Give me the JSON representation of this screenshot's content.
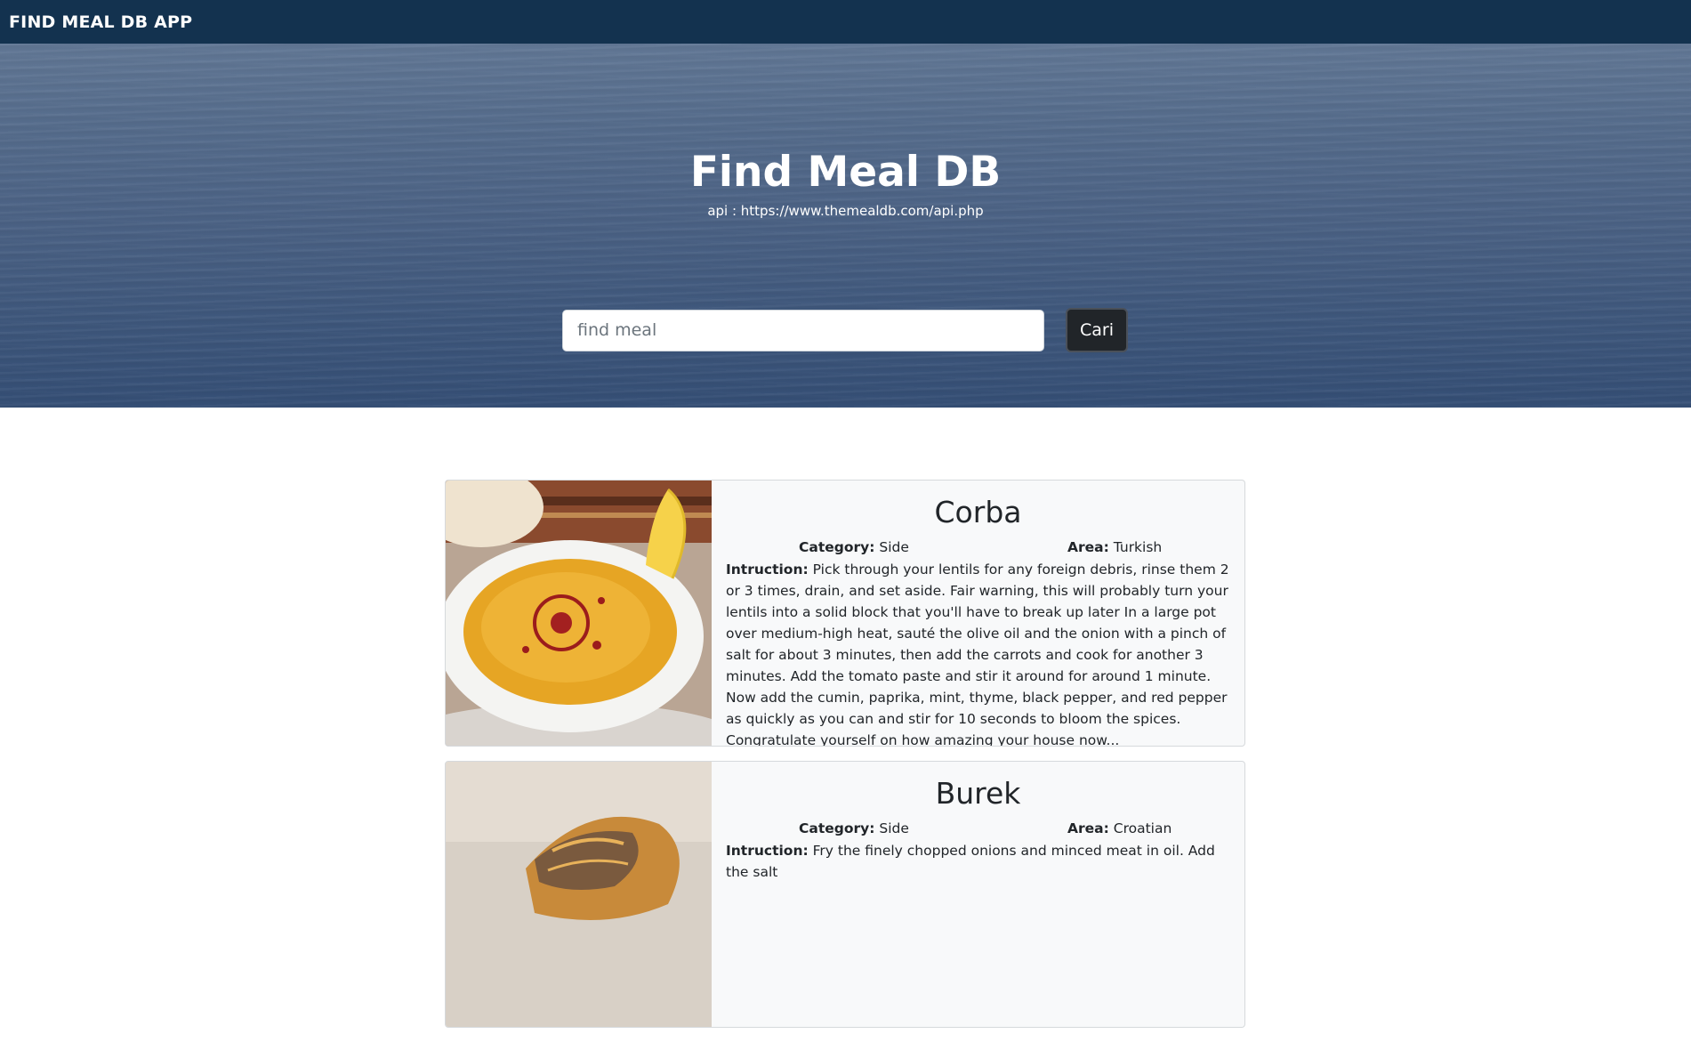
{
  "navbar": {
    "brand": "FIND MEAL DB APP"
  },
  "hero": {
    "title": "Find Meal DB",
    "api_note": "api : https://www.themealdb.com/api.php",
    "search": {
      "placeholder": "find meal",
      "value": "",
      "button_label": "Cari"
    }
  },
  "labels": {
    "category": "Category:",
    "area": "Area:",
    "instruction": "Intruction:"
  },
  "meals": [
    {
      "name": "Corba",
      "category": "Side",
      "area": "Turkish",
      "instruction": "Pick through your lentils for any foreign debris, rinse them 2 or 3 times, drain, and set aside. Fair warning, this will probably turn your lentils into a solid block that you'll have to break up later In a large pot over medium-high heat, sauté the olive oil and the onion with a pinch of salt for about 3 minutes, then add the carrots and cook for another 3 minutes. Add the tomato paste and stir it around for around 1 minute. Now add the cumin, paprika, mint, thyme, black pepper, and red pepper as quickly as you can and stir for 10 seconds to bloom the spices. Congratulate yourself on how amazing your house now..."
    },
    {
      "name": "Burek",
      "category": "Side",
      "area": "Croatian",
      "instruction": "Fry the finely chopped onions and minced meat in oil. Add the salt"
    }
  ]
}
